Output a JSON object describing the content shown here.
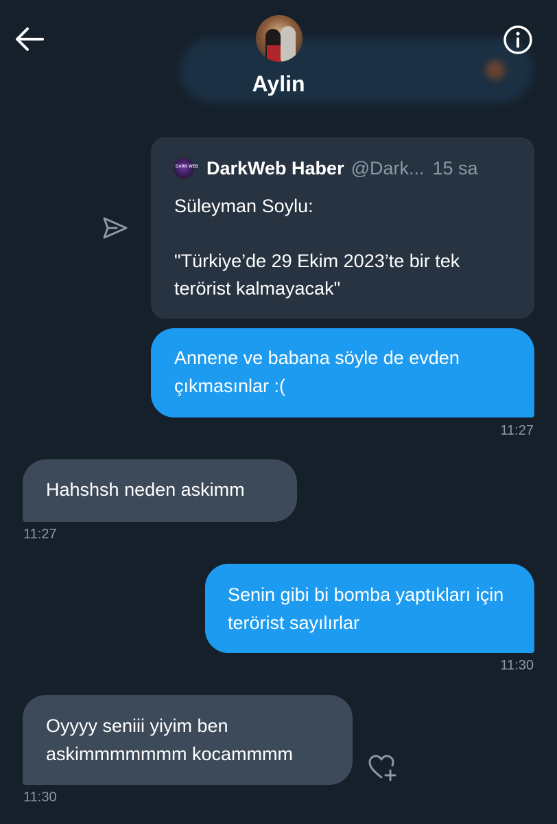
{
  "header": {
    "contact_name": "Aylin"
  },
  "shared_tweet": {
    "author_name": "DarkWeb Haber",
    "author_handle": "@Dark...",
    "time_ago": "15 sa",
    "avatar_text": "DARK WEB",
    "text_line1": "Süleyman Soylu:",
    "text_line2": "\"Türkiye’de 29 Ekim 2023’te bir tek terörist kalmayacak\""
  },
  "messages": [
    {
      "direction": "outgoing",
      "text": "Annene ve babana söyle de evden çıkmasınlar :(",
      "time": "11:27"
    },
    {
      "direction": "incoming",
      "text": "Hahshsh neden askimm",
      "time": "11:27"
    },
    {
      "direction": "outgoing",
      "text": "Senin gibi bi bomba yaptıkları için terörist sayılırlar",
      "time": "11:30"
    },
    {
      "direction": "incoming",
      "text": "Oyyyy seniii yiyim ben askimmmmmmm kocammmm",
      "time": "11:30"
    }
  ],
  "icons": {
    "back": "arrow-left-icon",
    "info": "info-circle-icon",
    "share": "share-arrow-icon",
    "react": "heart-plus-icon"
  },
  "colors": {
    "background": "#15202b",
    "outgoing_bubble": "#1d9bf0",
    "incoming_bubble": "#3d4a5a",
    "quote_card": "#273340",
    "muted_text": "#8b98a5"
  }
}
